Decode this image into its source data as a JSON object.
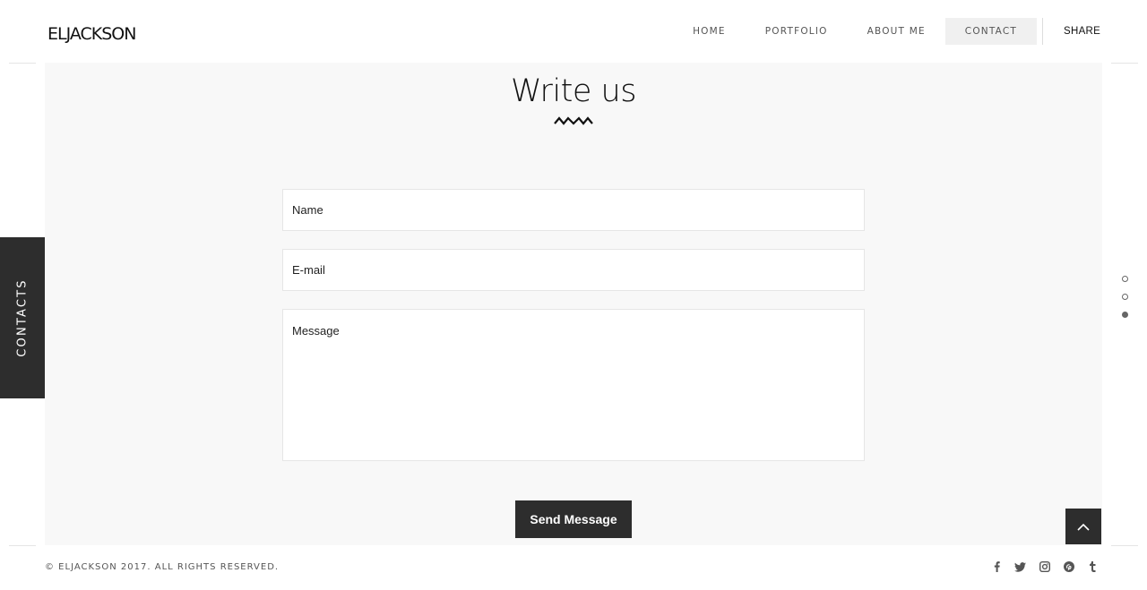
{
  "header": {
    "logo": "ELJACKSON",
    "nav": [
      {
        "label": "HOME"
      },
      {
        "label": "PORTFOLIO"
      },
      {
        "label": "ABOUT ME"
      },
      {
        "label": "CONTACT"
      }
    ],
    "active_nav": "CONTACT",
    "share_label": "SHARE"
  },
  "main": {
    "title": "Write us",
    "form": {
      "name_placeholder": "Name",
      "email_placeholder": "E-mail",
      "message_placeholder": "Message",
      "submit_label": "Send Message"
    }
  },
  "side_tab": {
    "label": "CONTACTS"
  },
  "section_dots": {
    "count": 3,
    "active_index": 2
  },
  "footer": {
    "copyright": "© ELJACKSON 2017. ALL RIGHTS RESERVED.",
    "social_icons": [
      "facebook-icon",
      "twitter-icon",
      "instagram-icon",
      "pinterest-icon",
      "tumblr-icon"
    ]
  },
  "colors": {
    "dark": "#2d2d2d",
    "panel_bg": "#f8f8f8",
    "active_nav_bg": "#f0f0f0"
  }
}
